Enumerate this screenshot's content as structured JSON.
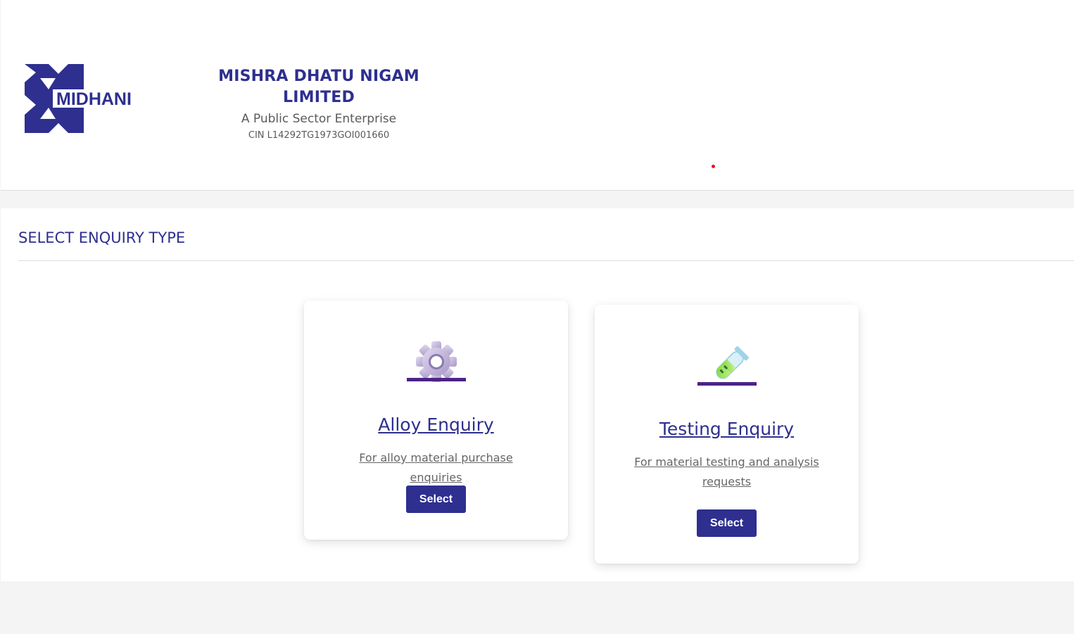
{
  "header": {
    "logo_text": "MIDHANI",
    "company_name": "MISHRA DHATU NIGAM LIMITED",
    "tagline": "A Public Sector Enterprise",
    "cin": "CIN L14292TG1973GOI001660"
  },
  "main": {
    "section_title": "SELECT ENQUIRY TYPE",
    "cards": [
      {
        "icon": "gear-icon",
        "title": "Alloy Enquiry",
        "description": "For alloy material purchase enquiries",
        "button_label": "Select"
      },
      {
        "icon": "test-tube-icon",
        "title": "Testing Enquiry",
        "description": "For material testing and analysis requests",
        "button_label": "Select"
      }
    ]
  },
  "colors": {
    "brand": "#2e2f8f",
    "accent_red": "#e01a22",
    "page_bg": "#f4f4f4"
  }
}
